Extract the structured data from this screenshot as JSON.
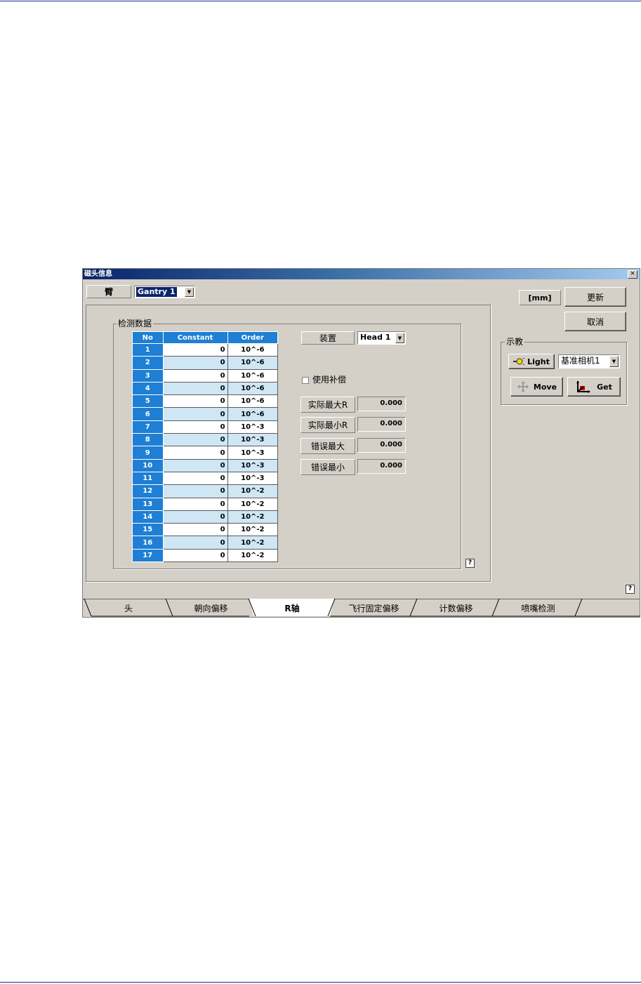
{
  "window": {
    "title": "磁头信息",
    "close": "×"
  },
  "arm": {
    "label": "臂",
    "value": "Gantry 1"
  },
  "detection": {
    "title": "检测数据",
    "columns": [
      "No",
      "Constant",
      "Order"
    ],
    "rows": [
      {
        "no": "1",
        "constant": "0",
        "order": "10^-6"
      },
      {
        "no": "2",
        "constant": "0",
        "order": "10^-6"
      },
      {
        "no": "3",
        "constant": "0",
        "order": "10^-6"
      },
      {
        "no": "4",
        "constant": "0",
        "order": "10^-6"
      },
      {
        "no": "5",
        "constant": "0",
        "order": "10^-6"
      },
      {
        "no": "6",
        "constant": "0",
        "order": "10^-6"
      },
      {
        "no": "7",
        "constant": "0",
        "order": "10^-3"
      },
      {
        "no": "8",
        "constant": "0",
        "order": "10^-3"
      },
      {
        "no": "9",
        "constant": "0",
        "order": "10^-3"
      },
      {
        "no": "10",
        "constant": "0",
        "order": "10^-3"
      },
      {
        "no": "11",
        "constant": "0",
        "order": "10^-3"
      },
      {
        "no": "12",
        "constant": "0",
        "order": "10^-2"
      },
      {
        "no": "13",
        "constant": "0",
        "order": "10^-2"
      },
      {
        "no": "14",
        "constant": "0",
        "order": "10^-2"
      },
      {
        "no": "15",
        "constant": "0",
        "order": "10^-2"
      },
      {
        "no": "16",
        "constant": "0",
        "order": "10^-2"
      },
      {
        "no": "17",
        "constant": "0",
        "order": "10^-2"
      }
    ],
    "device_label": "装置",
    "device_value": "Head 1",
    "use_compensation": "使用补偿",
    "actual_max_r": {
      "label": "实际最大R",
      "value": "0.000"
    },
    "actual_min_r": {
      "label": "实际最小R",
      "value": "0.000"
    },
    "error_max": {
      "label": "错误最大",
      "value": "0.000"
    },
    "error_min": {
      "label": "错误最小",
      "value": "0.000"
    },
    "help": "?"
  },
  "unit": "[mm]",
  "buttons": {
    "update": "更新",
    "cancel": "取消"
  },
  "teach": {
    "title": "示教",
    "light": "Light",
    "camera": "基准相机1",
    "move": "Move",
    "get": "Get"
  },
  "help": "?",
  "tabs": [
    "头",
    "朝向偏移",
    "R轴",
    "飞行固定偏移",
    "计数偏移",
    "喷嘴检测"
  ],
  "active_tab": "R轴"
}
